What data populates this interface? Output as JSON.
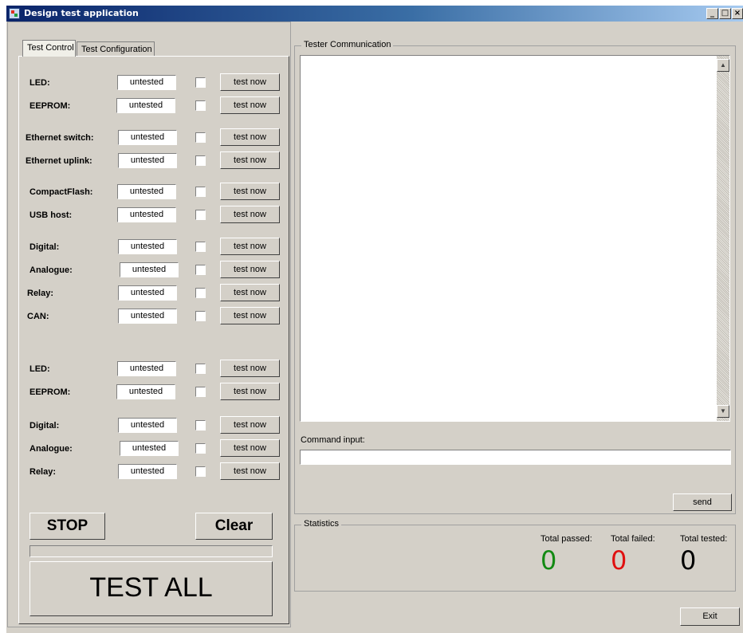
{
  "window": {
    "title": "Design test application",
    "minimize": "_",
    "maximize": "□",
    "close": "×"
  },
  "tabs": [
    "Test Control",
    "Test Configuration"
  ],
  "status_default": "untested",
  "test_now_label": "test now",
  "tests": [
    {
      "label": "LED:",
      "status": "untested",
      "button": "test now"
    },
    {
      "label": "EEPROM:",
      "status": "untested",
      "button": "test now"
    },
    {
      "label": "Ethernet switch:",
      "status": "untested",
      "button": "test now"
    },
    {
      "label": "Ethernet uplink:",
      "status": "untested",
      "button": "test now"
    },
    {
      "label": "CompactFlash:",
      "status": "untested",
      "button": "test now"
    },
    {
      "label": "USB host:",
      "status": "untested",
      "button": "test now"
    },
    {
      "label": "Digital:",
      "status": "untested",
      "button": "test now"
    },
    {
      "label": "Analogue:",
      "status": "untested",
      "button": "test now"
    },
    {
      "label": "Relay:",
      "status": "untested",
      "button": "test now"
    },
    {
      "label": "CAN:",
      "status": "untested",
      "button": "test now"
    },
    {
      "label": "LED:",
      "status": "untested",
      "button": "test now"
    },
    {
      "label": "EEPROM:",
      "status": "untested",
      "button": "test now"
    },
    {
      "label": "Digital:",
      "status": "untested",
      "button": "test now"
    },
    {
      "label": "Analogue:",
      "status": "untested",
      "button": "test now"
    },
    {
      "label": "Relay:",
      "status": "untested",
      "button": "test now"
    }
  ],
  "controls": {
    "stop": "STOP",
    "clear": "Clear",
    "test_all": "TEST ALL"
  },
  "communication": {
    "group_title": "Tester Communication",
    "command_label": "Command input:",
    "command_value": "",
    "send": "send"
  },
  "statistics": {
    "group_title": "Statistics",
    "passed_label": "Total passed:",
    "failed_label": "Total failed:",
    "tested_label": "Total tested:",
    "passed": "0",
    "failed": "0",
    "tested": "0",
    "passed_color": "#138a13",
    "failed_color": "#e01010",
    "tested_color": "#000000"
  },
  "exit_label": "Exit"
}
